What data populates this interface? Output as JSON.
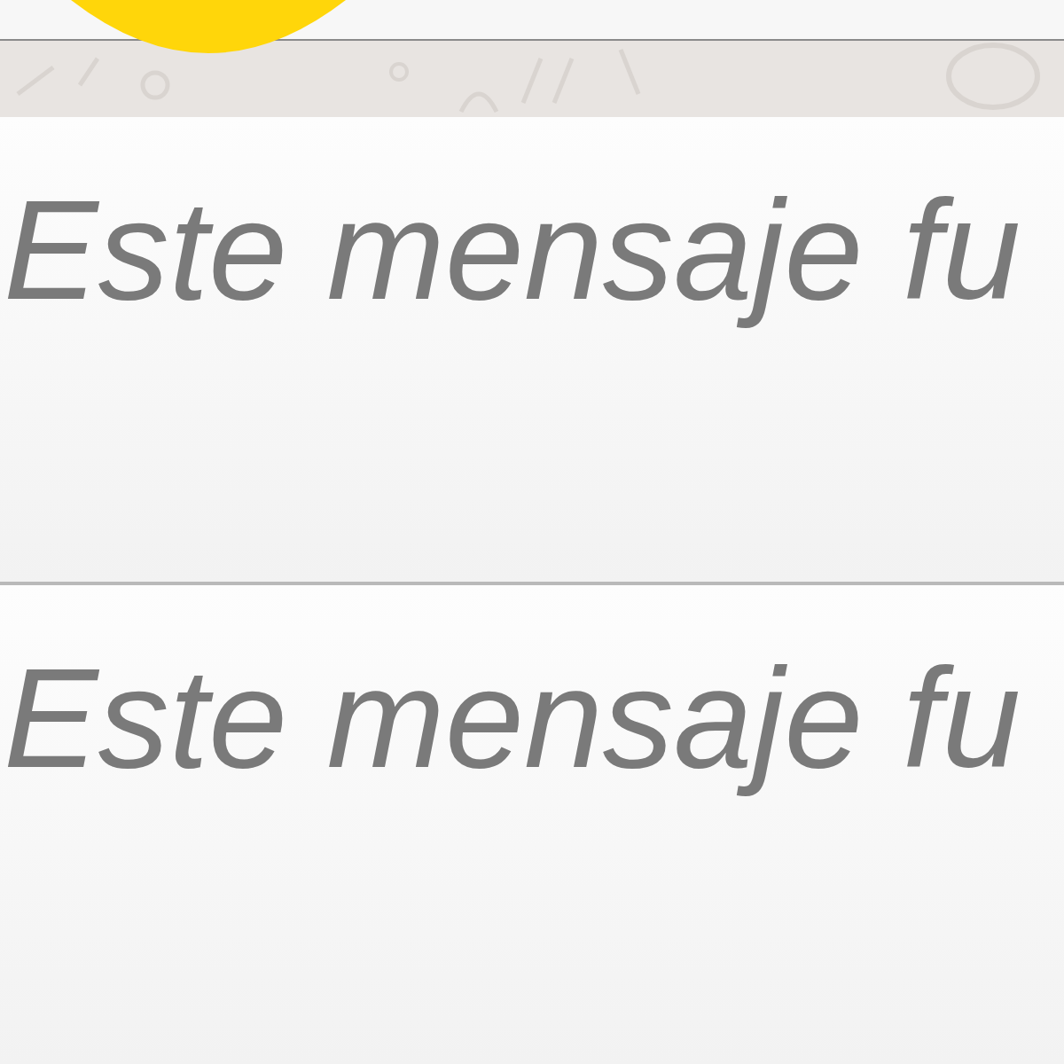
{
  "messages": [
    {
      "text": "Este mensaje fu"
    },
    {
      "text": "Este mensaje fu"
    }
  ]
}
